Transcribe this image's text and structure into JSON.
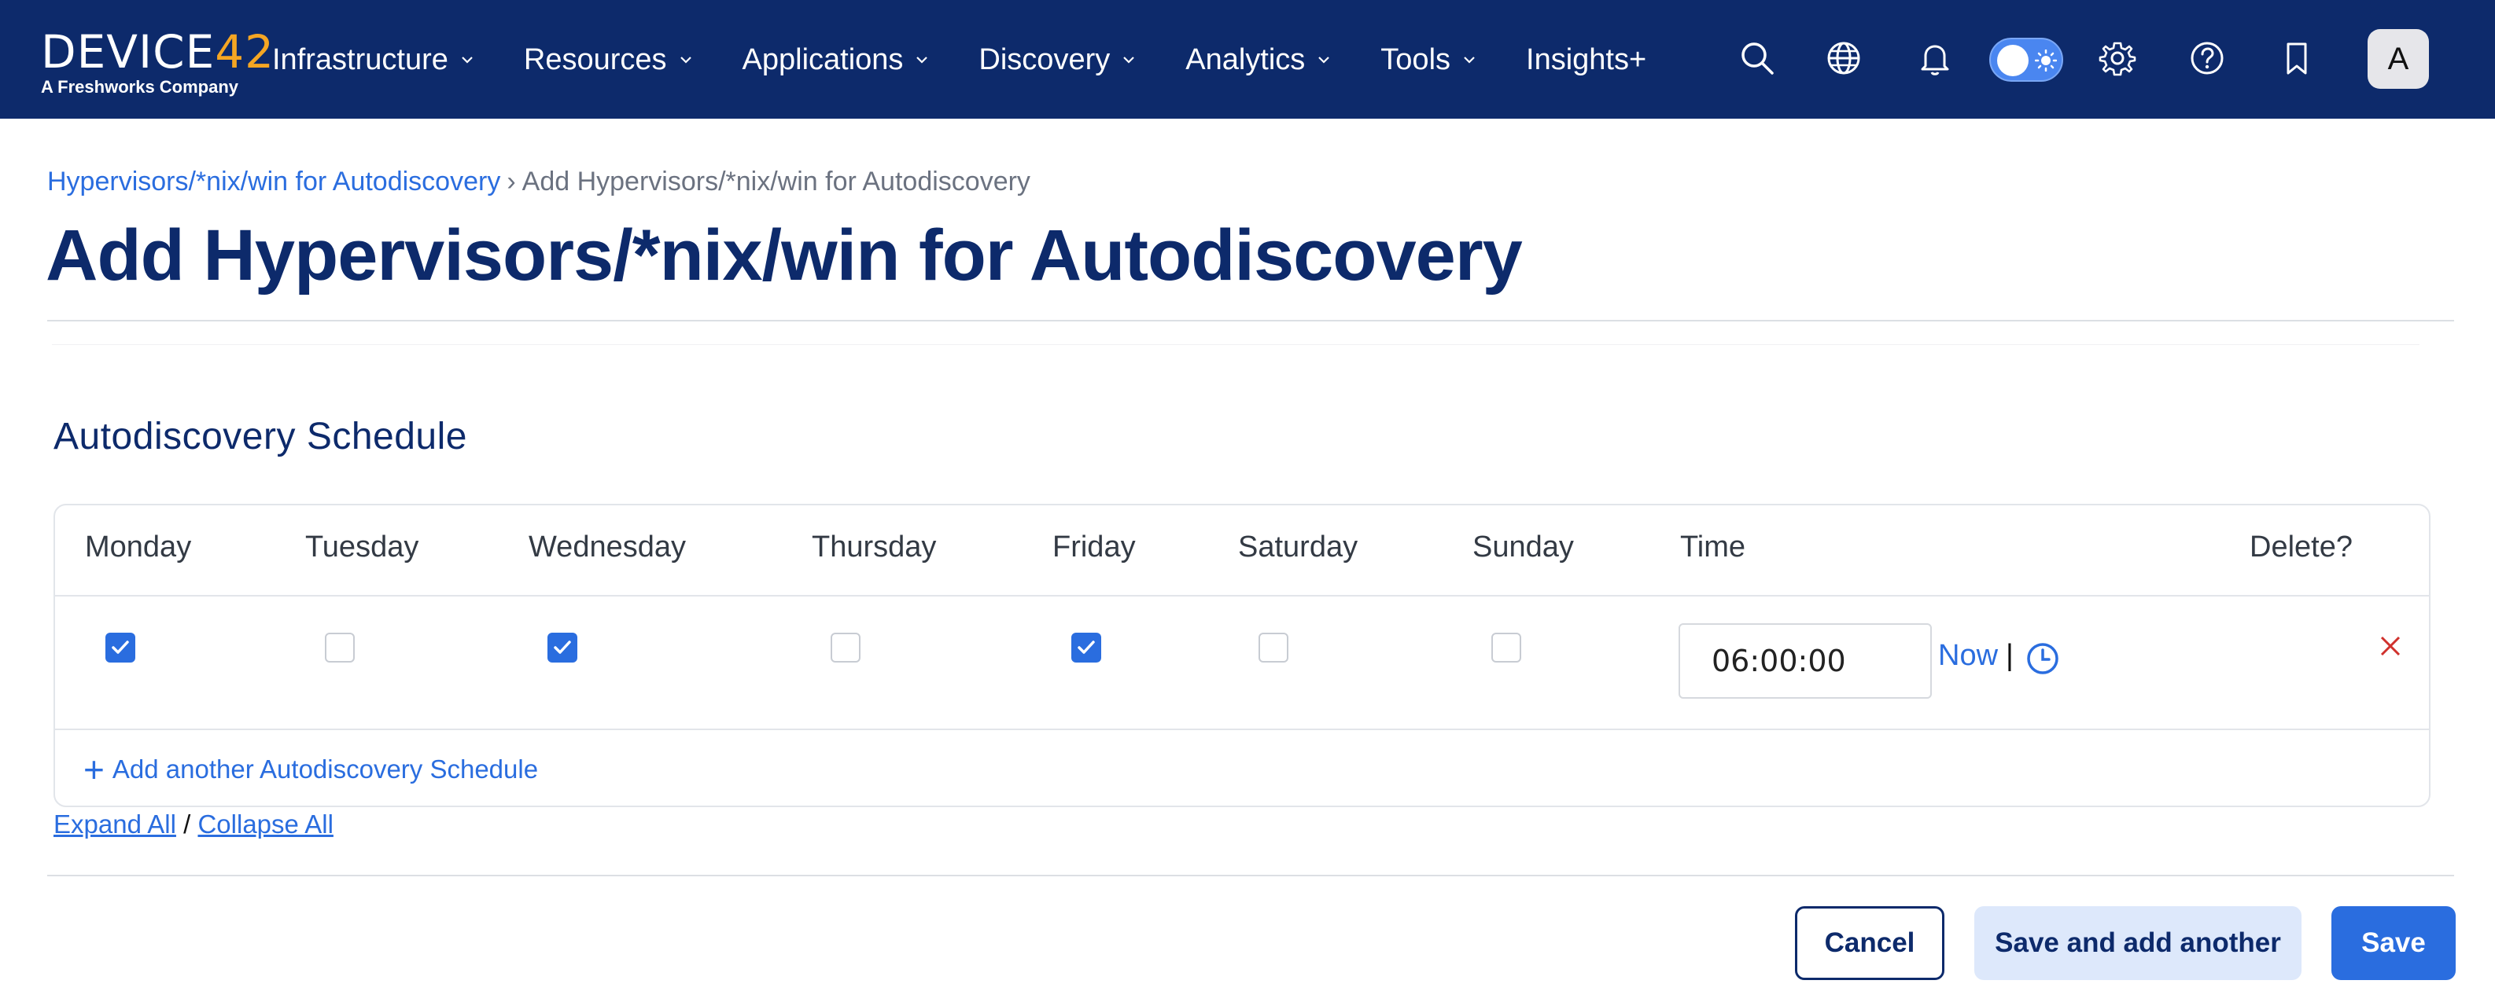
{
  "brand": {
    "logo_main": "DEVICE",
    "logo_accent": "42",
    "logo_sub": "A Freshworks Company"
  },
  "nav": {
    "items": [
      {
        "label": "Infrastructure",
        "has_dropdown": true
      },
      {
        "label": "Resources",
        "has_dropdown": true
      },
      {
        "label": "Applications",
        "has_dropdown": true
      },
      {
        "label": "Discovery",
        "has_dropdown": true
      },
      {
        "label": "Analytics",
        "has_dropdown": true
      },
      {
        "label": "Tools",
        "has_dropdown": true
      },
      {
        "label": "Insights+",
        "has_dropdown": false
      }
    ],
    "icons": [
      "search-icon",
      "globe-icon",
      "bell-icon",
      "theme-toggle",
      "gear-icon",
      "help-icon",
      "bookmark-icon"
    ],
    "avatar_letter": "A"
  },
  "breadcrumb": {
    "parent": "Hypervisors/*nix/win for Autodiscovery",
    "separator": "›",
    "current": "Add Hypervisors/*nix/win for Autodiscovery"
  },
  "page_title": "Add Hypervisors/*nix/win for Autodiscovery",
  "schedule": {
    "section_title": "Autodiscovery Schedule",
    "columns": [
      "Monday",
      "Tuesday",
      "Wednesday",
      "Thursday",
      "Friday",
      "Saturday",
      "Sunday",
      "Time",
      "Delete?"
    ],
    "rows": [
      {
        "days": [
          true,
          false,
          true,
          false,
          true,
          false,
          false
        ],
        "time": "06:00:00",
        "now_label": "Now",
        "pipe": "|"
      }
    ],
    "add_label": "Add another Autodiscovery Schedule",
    "add_plus": "+"
  },
  "expand_all": "Expand All",
  "expand_sep": "/",
  "collapse_all": "Collapse All",
  "buttons": {
    "cancel": "Cancel",
    "save_add": "Save and add another",
    "save": "Save"
  },
  "colors": {
    "navbar": "#0d2a6b",
    "accent": "#2a6ddf",
    "logo_accent": "#f5a623",
    "delete": "#d0312d"
  }
}
